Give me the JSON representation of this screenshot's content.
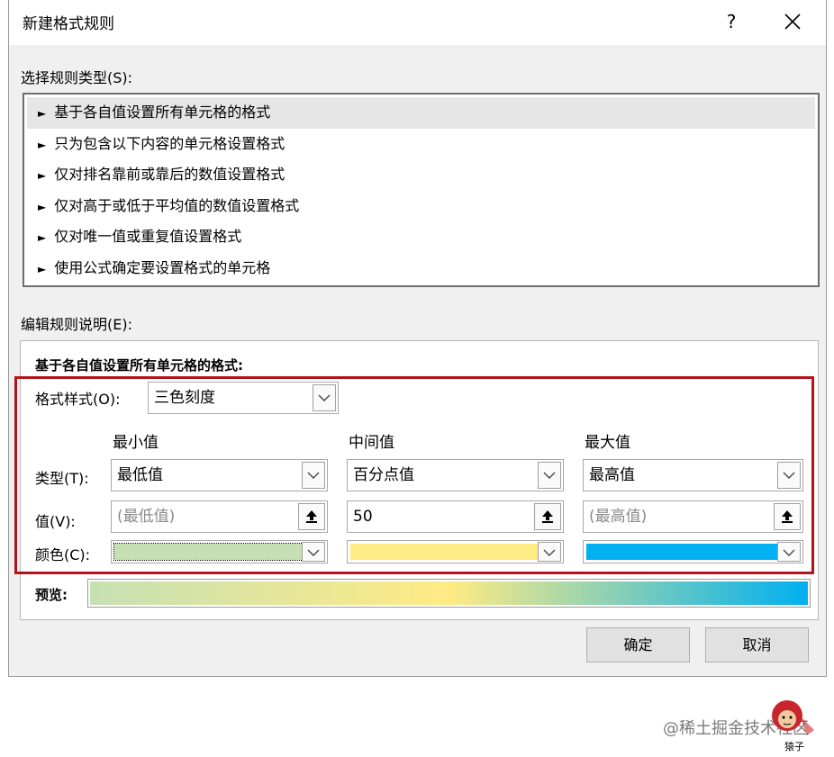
{
  "dialog": {
    "title": "新建格式规则",
    "help": "?",
    "rule_type_label": "选择规则类型(S):",
    "rule_types": [
      "基于各自值设置所有单元格的格式",
      "只为包含以下内容的单元格设置格式",
      "仅对排名靠前或靠后的数值设置格式",
      "仅对高于或低于平均值的数值设置格式",
      "仅对唯一值或重复值设置格式",
      "使用公式确定要设置格式的单元格"
    ],
    "rule_type_marker": "►",
    "edit_label": "编辑规则说明(E):",
    "desc_heading": "基于各自值设置所有单元格的格式:",
    "format_style_label": "格式样式(O):",
    "format_style_value": "三色刻度",
    "columns": {
      "min": {
        "header": "最小值",
        "type": "最低值",
        "value_placeholder": "(最低值)",
        "value": "",
        "color": "#c6e0b4"
      },
      "mid": {
        "header": "中间值",
        "type": "百分点值",
        "value_placeholder": "",
        "value": "50",
        "color": "#ffeb84"
      },
      "max": {
        "header": "最大值",
        "type": "最高值",
        "value_placeholder": "(最高值)",
        "value": "",
        "color": "#00b0f0"
      }
    },
    "row_labels": {
      "type": "类型(T):",
      "value": "值(V):",
      "color": "颜色(C):"
    },
    "preview_label": "预览:",
    "ok_label": "确定",
    "cancel_label": "取消"
  },
  "watermark": {
    "text": "@稀土掘金技术社区",
    "badge_label": "猿子"
  },
  "colors": {
    "highlight_frame": "#b3141b",
    "selected_row": "#e6e6e6"
  }
}
